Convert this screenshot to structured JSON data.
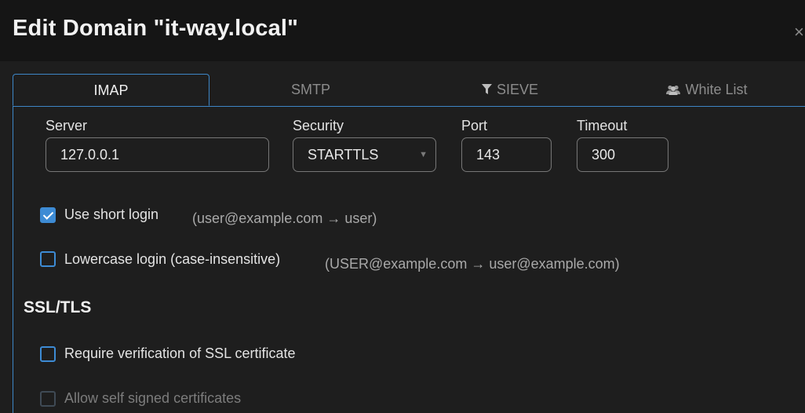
{
  "dialog": {
    "title": "Edit Domain \"it-way.local\"",
    "close_label": "×"
  },
  "tabs": [
    {
      "label": "IMAP",
      "icon": ""
    },
    {
      "label": "SMTP",
      "icon": ""
    },
    {
      "label": "SIEVE",
      "icon": "filter-icon"
    },
    {
      "label": "White List",
      "icon": "users-icon"
    }
  ],
  "connection": {
    "server": {
      "label": "Server",
      "value": "127.0.0.1"
    },
    "security": {
      "label": "Security",
      "value": "STARTTLS"
    },
    "port": {
      "label": "Port",
      "value": "143"
    },
    "timeout": {
      "label": "Timeout",
      "value": "300"
    }
  },
  "options": {
    "short_login": {
      "label": "Use short login",
      "hint": "(user@example.com → user)",
      "checked": true
    },
    "lowercase_login": {
      "label": "Lowercase login (case-insensitive)",
      "hint": "(USER@example.com → user@example.com)",
      "checked": false
    }
  },
  "ssl": {
    "title": "SSL/TLS",
    "verify": {
      "label": "Require verification of SSL certificate",
      "checked": false
    },
    "self_signed": {
      "label": "Allow self signed certificates",
      "checked": false,
      "disabled": true
    }
  },
  "colors": {
    "accent": "#3d8bd4",
    "background": "#1e1e1e",
    "header": "#151515"
  }
}
